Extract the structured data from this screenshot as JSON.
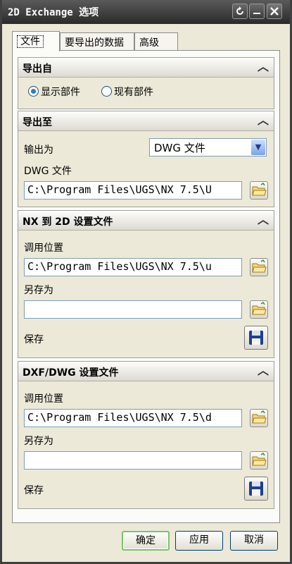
{
  "window": {
    "title": "2D Exchange 选项"
  },
  "titlebar_buttons": {
    "help": "?",
    "minimize": "—",
    "close": "✕"
  },
  "tabs": [
    {
      "label": "文件",
      "active": true
    },
    {
      "label": "要导出的数据",
      "active": false
    },
    {
      "label": "高级",
      "active": false
    }
  ],
  "export_from": {
    "header": "导出自",
    "options": [
      {
        "label": "显示部件",
        "selected": true
      },
      {
        "label": "现有部件",
        "selected": false
      }
    ]
  },
  "export_to": {
    "header": "导出至",
    "output_label": "输出为",
    "output_value": "DWG 文件",
    "file_label": "DWG 文件",
    "file_path": "C:\\Program Files\\UGS\\NX 7.5\\U"
  },
  "nx2d_settings": {
    "header": "NX 到 2D 设置文件",
    "load_label": "调用位置",
    "load_path": "C:\\Program Files\\UGS\\NX 7.5\\u",
    "saveas_label": "另存为",
    "saveas_path": "",
    "save_label": "保存"
  },
  "dxf_settings": {
    "header": "DXF/DWG 设置文件",
    "load_label": "调用位置",
    "load_path": "C:\\Program Files\\UGS\\NX 7.5\\d",
    "saveas_label": "另存为",
    "saveas_path": "",
    "save_label": "保存"
  },
  "footer": {
    "ok": "确定",
    "apply": "应用",
    "cancel": "取消"
  },
  "icons": {
    "collapse": "chevron-up-icon",
    "browse": "folder-open-icon",
    "save": "floppy-disk-icon",
    "dropdown": "chevron-down-icon"
  },
  "colors": {
    "accent": "#2e7bd0",
    "ok_border": "#79c36a",
    "titlebar": "#3a3a3a"
  }
}
